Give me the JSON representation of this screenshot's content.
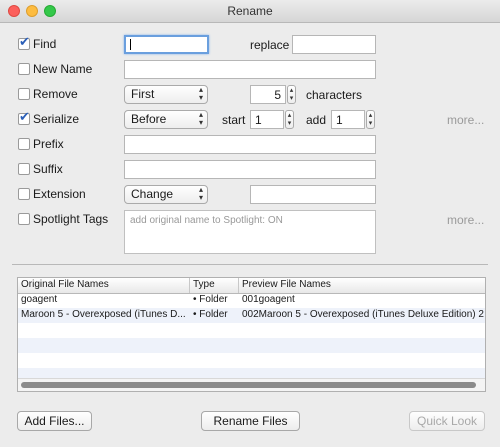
{
  "window": {
    "title": "Rename"
  },
  "options": {
    "find": {
      "label": "Find",
      "checked": true,
      "value": ""
    },
    "replace": {
      "label": "replace",
      "value": ""
    },
    "new_name": {
      "label": "New Name",
      "checked": false,
      "value": ""
    },
    "remove": {
      "label": "Remove",
      "checked": false,
      "mode": "First",
      "count": "5",
      "unit_label": "characters"
    },
    "serialize": {
      "label": "Serialize",
      "checked": true,
      "position": "Before",
      "start_label": "start",
      "start": "1",
      "add_label": "add",
      "add": "1",
      "more": "more..."
    },
    "prefix": {
      "label": "Prefix",
      "checked": false,
      "value": ""
    },
    "suffix": {
      "label": "Suffix",
      "checked": false,
      "value": ""
    },
    "extension": {
      "label": "Extension",
      "checked": false,
      "mode": "Change",
      "value": ""
    },
    "spotlight": {
      "label": "Spotlight Tags",
      "checked": false,
      "note": "add original name to Spotlight: ON",
      "more": "more..."
    }
  },
  "table": {
    "columns": [
      "Original File Names",
      "Type",
      "Preview File Names"
    ],
    "rows": [
      {
        "original": "goagent",
        "type": "• Folder",
        "preview": "001goagent"
      },
      {
        "original": "Maroon 5 - Overexposed (iTunes D...",
        "type": "• Folder",
        "preview": "002Maroon 5 - Overexposed (iTunes Deluxe Edition) 2"
      }
    ]
  },
  "buttons": {
    "add_files": "Add Files...",
    "rename_files": "Rename Files",
    "quick_look": "Quick Look"
  },
  "glyphs": {
    "updown": "▴▾"
  }
}
